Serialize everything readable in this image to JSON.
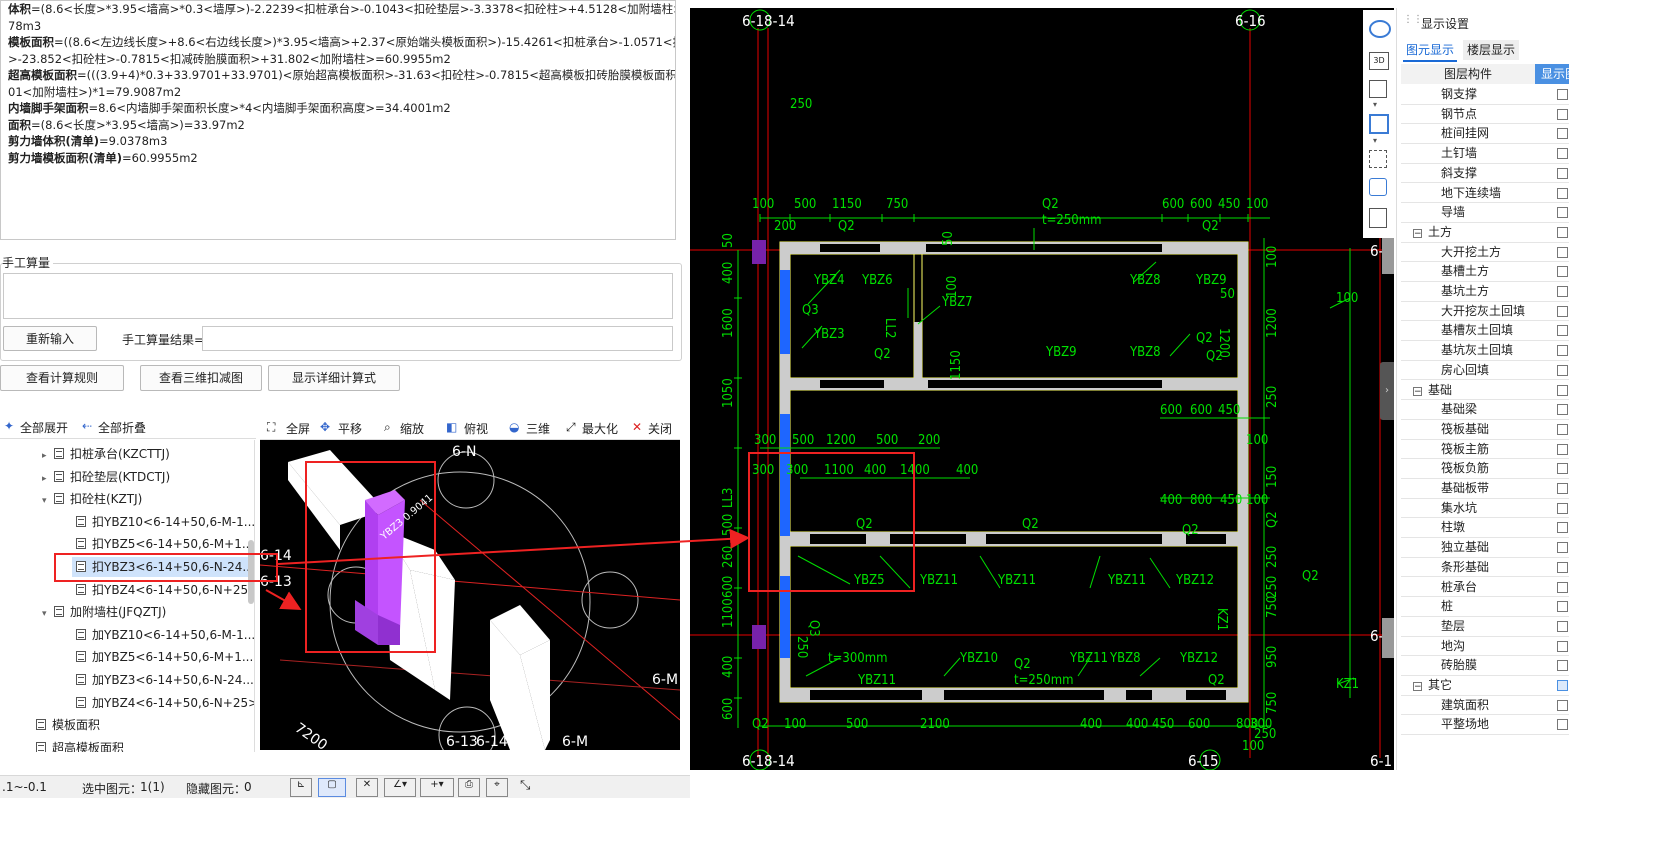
{
  "formula": {
    "lines": [
      {
        "label": "体积",
        "text": "=(8.6<长度>*3.95<墙高>*0.3<墙厚>)-2.2239<扣桩承台>-0.1043<扣砼垫层>-3.3378<扣砼柱>+4.5128<加附墙柱>=9.03"
      },
      {
        "label": "",
        "text": "78m3"
      },
      {
        "label": "模板面积",
        "text": "=((8.6<左边线长度>+8.6<右边线长度>)*3.95<墙高>+2.37<原始端头模板面积>)-15.4261<扣桩承台>-1.0571<扣垫层"
      },
      {
        "label": "",
        "text": ">-23.852<扣砼柱>-0.7815<扣减砖胎膜面积>+31.802<加附墙柱>=60.9955m2"
      },
      {
        "label": "超高模板面积",
        "text": "=(((3.9+4)*0.3+33.9701+33.9701)<原始超高模板面积>-31.63<扣砼柱>-0.7815<超高模板扣砖胎膜模板面积>+42."
      },
      {
        "label": "",
        "text": "01<加附墙柱>)*1=79.9087m2"
      },
      {
        "label": "内墙脚手架面积",
        "text": "=8.6<内墙脚手架面积长度>*4<内墙脚手架面积高度>=34.4001m2"
      },
      {
        "label": "面积",
        "text": "=(8.6<长度>*3.95<墙高>)=33.97m2"
      },
      {
        "label": "剪力墙体积(清单)",
        "text": "=9.0378m3"
      },
      {
        "label": "剪力墙模板面积(清单)",
        "text": "=60.9955m2"
      }
    ]
  },
  "manual": {
    "group_title": "手工算量",
    "reenter_button": "重新输入",
    "result_label": "手工算量结果="
  },
  "actions": {
    "rules_button": "查看计算规则",
    "view3d_button": "查看三维扣减图",
    "detail_button": "显示详细计算式"
  },
  "tree": {
    "expand_all": "全部展开",
    "collapse_all": "全部折叠",
    "items": [
      {
        "label": "扣桩承台(KZCTTJ)",
        "level": 1,
        "toggle": "▸"
      },
      {
        "label": "扣砼垫层(KTDCTJ)",
        "level": 1,
        "toggle": "▸"
      },
      {
        "label": "扣砼柱(KZTJ)",
        "level": 1,
        "toggle": "▾"
      },
      {
        "label": "扣YBZ10<6-14+50,6-M-1...",
        "level": 2,
        "toggle": ""
      },
      {
        "label": "扣YBZ5<6-14+50,6-M+1...",
        "level": 2,
        "toggle": ""
      },
      {
        "label": "扣YBZ3<6-14+50,6-N-24...",
        "level": 2,
        "toggle": "",
        "selected": true
      },
      {
        "label": "扣YBZ4<6-14+50,6-N+25>",
        "level": 2,
        "toggle": ""
      },
      {
        "label": "加附墙柱(JFQZTJ)",
        "level": 1,
        "toggle": "▾"
      },
      {
        "label": "加YBZ10<6-14+50,6-M-1...",
        "level": 2,
        "toggle": ""
      },
      {
        "label": "加YBZ5<6-14+50,6-M+1...",
        "level": 2,
        "toggle": ""
      },
      {
        "label": "加YBZ3<6-14+50,6-N-24...",
        "level": 2,
        "toggle": ""
      },
      {
        "label": "加YBZ4<6-14+50,6-N+25>",
        "level": 2,
        "toggle": ""
      },
      {
        "label": "模板面积",
        "level": 0,
        "toggle": ""
      },
      {
        "label": "超高模板面积",
        "level": 0,
        "toggle": ""
      }
    ]
  },
  "view_toolbar": {
    "fullscreen": "全屏",
    "pan": "平移",
    "zoom": "缩放",
    "top_view": "俯视",
    "three_d": "三维",
    "maximize": "最大化",
    "close": "关闭"
  },
  "view3d": {
    "labels": [
      "6-N",
      "6-14",
      "6-13",
      "6-13",
      "6-14",
      "6-M",
      "6-M",
      "7200",
      "YBZ3 0.9041"
    ]
  },
  "status": {
    "coord": ".1~-0.1",
    "selected_label": "选中图元：",
    "selected_value": "1(1)",
    "hidden_label": "隐藏图元：",
    "hidden_value": "0"
  },
  "cad": {
    "top_axis_left": "6-18-14",
    "top_axis_right": "6-16",
    "bottom_axis_left": "6-18-14",
    "bottom_axis_right": "6-15",
    "right_axis_a": "6-",
    "right_axis_b": "6-",
    "right_axis_c": "6-1",
    "texts": [
      "100",
      "500",
      "1150",
      "750",
      "Q2",
      "t=250mm",
      "600",
      "600",
      "450",
      "100",
      "200",
      "Q2",
      "Q2",
      "YBZ4",
      "YBZ6",
      "YBZ7",
      "YBZ8",
      "YBZ9",
      "YBZ3",
      "Q2",
      "Q2",
      "YBZ8",
      "YBZ9",
      "Q2",
      "LL2",
      "Q3",
      "1150",
      "100",
      "50",
      "1600",
      "1050",
      "400",
      "50",
      "1200",
      "250",
      "600",
      "600",
      "450",
      "100",
      "300",
      "500",
      "1200",
      "500",
      "200",
      "300",
      "300",
      "1100",
      "400",
      "1400",
      "400",
      "400",
      "800",
      "450",
      "100",
      "Q2",
      "Q2",
      "LL3",
      "500",
      "260",
      "YBZ5",
      "YBZ11",
      "YBZ11",
      "YBZ11",
      "YBZ12",
      "Q2",
      "600",
      "1100",
      "400",
      "600",
      "250",
      "Q3",
      "t=300mm",
      "YBZ10",
      "YBZ11",
      "Q2",
      "t=250mm",
      "YBZ11",
      "YBZ8",
      "YBZ12",
      "Q2",
      "Q2",
      "100",
      "500",
      "2100",
      "400",
      "400",
      "450",
      "600",
      "800",
      "300",
      "100",
      "150",
      "250",
      "750",
      "950",
      "750",
      "250",
      "100",
      "KZ1",
      "KZ1",
      "Q2",
      "100",
      "250",
      "50",
      "1200",
      "Q2",
      "250"
    ]
  },
  "right_panel": {
    "header": "显示设置",
    "tab_element": "图元显示",
    "tab_floor": "楼层显示",
    "col_component": "图层构件",
    "col_display": "显示图",
    "rows": [
      {
        "label": "钢支撑",
        "group": false
      },
      {
        "label": "钢节点",
        "group": false
      },
      {
        "label": "桩间挂网",
        "group": false
      },
      {
        "label": "土钉墙",
        "group": false
      },
      {
        "label": "斜支撑",
        "group": false
      },
      {
        "label": "地下连续墙",
        "group": false
      },
      {
        "label": "导墙",
        "group": false
      },
      {
        "label": "土方",
        "group": true
      },
      {
        "label": "大开挖土方",
        "group": false
      },
      {
        "label": "基槽土方",
        "group": false
      },
      {
        "label": "基坑土方",
        "group": false
      },
      {
        "label": "大开挖灰土回填",
        "group": false
      },
      {
        "label": "基槽灰土回填",
        "group": false
      },
      {
        "label": "基坑灰土回填",
        "group": false
      },
      {
        "label": "房心回填",
        "group": false
      },
      {
        "label": "基础",
        "group": true
      },
      {
        "label": "基础梁",
        "group": false
      },
      {
        "label": "筏板基础",
        "group": false
      },
      {
        "label": "筏板主筋",
        "group": false
      },
      {
        "label": "筏板负筋",
        "group": false
      },
      {
        "label": "基础板带",
        "group": false
      },
      {
        "label": "集水坑",
        "group": false
      },
      {
        "label": "柱墩",
        "group": false
      },
      {
        "label": "独立基础",
        "group": false
      },
      {
        "label": "条形基础",
        "group": false
      },
      {
        "label": "桩承台",
        "group": false
      },
      {
        "label": "桩",
        "group": false
      },
      {
        "label": "垫层",
        "group": false
      },
      {
        "label": "地沟",
        "group": false
      },
      {
        "label": "砖胎膜",
        "group": false
      },
      {
        "label": "其它",
        "group": true
      },
      {
        "label": "建筑面积",
        "group": false
      },
      {
        "label": "平整场地",
        "group": false
      }
    ]
  },
  "colors": {
    "cad_bg": "#000000",
    "dim_green": "#00e000",
    "wall_yellow": "#ffff66",
    "axis_red": "#e60000",
    "column_blue": "#1e66ff",
    "annot_red": "#ee2222",
    "highlight_purple": "#c050ff"
  }
}
